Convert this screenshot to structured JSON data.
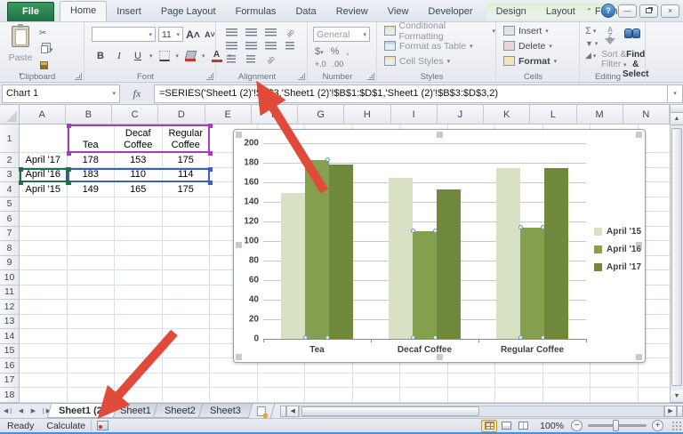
{
  "icons": {
    "caret": "▾",
    "up_caret": "▴",
    "left": "◀",
    "right": "▶",
    "first": "⏴❘",
    "last": "❘⏵",
    "minimize": "—",
    "close": "×",
    "help": "?",
    "chevron_up": "⌃",
    "sum": "Σ",
    "fill_down": "⬇",
    "clear": "◢",
    "scissors": "✂",
    "fx": "fx",
    "az": "A↓Z",
    "up_arrow": "▲",
    "down_arrow": "▼"
  },
  "ribbon": {
    "tabs": [
      {
        "label": "File"
      },
      {
        "label": "Home"
      },
      {
        "label": "Insert"
      },
      {
        "label": "Page Layout"
      },
      {
        "label": "Formulas"
      },
      {
        "label": "Data"
      },
      {
        "label": "Review"
      },
      {
        "label": "View"
      },
      {
        "label": "Developer"
      },
      {
        "label": "Design"
      },
      {
        "label": "Layout"
      },
      {
        "label": "Format"
      }
    ],
    "clipboard": {
      "label": "Clipboard",
      "paste": "Paste"
    },
    "font": {
      "label": "Font",
      "font_name": "",
      "font_size": "11",
      "bold": "B",
      "italic": "I",
      "underline": "U"
    },
    "alignment": {
      "label": "Alignment"
    },
    "number": {
      "label": "Number",
      "format": "General",
      "currency": "$",
      "percent": "%",
      "comma": ",",
      "inc_dec": "+.0",
      "dec_dec": ".00"
    },
    "styles": {
      "label": "Styles",
      "conditional": "Conditional Formatting",
      "format_table": "Format as Table",
      "cell_styles": "Cell Styles"
    },
    "cells": {
      "label": "Cells",
      "insert": "Insert",
      "delete": "Delete",
      "format": "Format"
    },
    "editing": {
      "label": "Editing",
      "sort_line1": "Sort &",
      "sort_line2": "Filter",
      "find_line1": "Find &",
      "find_line2": "Select"
    }
  },
  "formula_bar": {
    "name_box": "Chart 1",
    "formula": "=SERIES('Sheet1 (2)'!$A$3,'Sheet1 (2)'!$B$1:$D$1,'Sheet1 (2)'!$B$3:$D$3,2)"
  },
  "grid": {
    "columns": [
      "A",
      "B",
      "C",
      "D",
      "E",
      "F",
      "G",
      "H",
      "I",
      "J",
      "K",
      "L",
      "M",
      "N"
    ],
    "row_count": 18,
    "cells": {
      "B1": "Tea",
      "C1": "Decaf Coffee",
      "D1": "Regular Coffee",
      "A2": "April '17",
      "B2": "178",
      "C2": "153",
      "D2": "175",
      "A3": "April '16",
      "B3": "183",
      "C3": "110",
      "D3": "114",
      "A4": "April '15",
      "B4": "149",
      "C4": "165",
      "D4": "175"
    },
    "selection_colors": {
      "series_name_range": "#A73BC0",
      "values_range": "#3B5FC0",
      "category_range": "#1E7145"
    }
  },
  "chart_data": {
    "type": "bar",
    "title": "",
    "categories": [
      "Tea",
      "Decaf Coffee",
      "Regular Coffee"
    ],
    "series": [
      {
        "name": "April '15",
        "values": [
          149,
          165,
          175
        ],
        "color": "#D8E1C3",
        "selected": false
      },
      {
        "name": "April '16",
        "values": [
          183,
          110,
          114
        ],
        "color": "#84A04E",
        "selected": true
      },
      {
        "name": "April '17",
        "values": [
          178,
          153,
          175
        ],
        "color": "#6F883C",
        "selected": false
      }
    ],
    "ylim": [
      0,
      200
    ],
    "ytick_step": 20,
    "grid": true,
    "legend_position": "right",
    "xlabel": "",
    "ylabel": ""
  },
  "annotations": {
    "arrow_color": "#DF4A3B",
    "arrows": [
      {
        "from": [
          365,
          215
        ],
        "to": [
          305,
          118
        ]
      },
      {
        "from": [
          196,
          374
        ],
        "to": [
          131,
          447
        ]
      }
    ]
  },
  "sheet_bar": {
    "tabs": [
      {
        "label": "Sheet1 (2)",
        "active": true
      },
      {
        "label": "Sheet1",
        "active": false
      },
      {
        "label": "Sheet2",
        "active": false
      },
      {
        "label": "Sheet3",
        "active": false
      }
    ]
  },
  "status_bar": {
    "mode": "Ready",
    "calculate": "Calculate",
    "zoom_level": "100%"
  }
}
